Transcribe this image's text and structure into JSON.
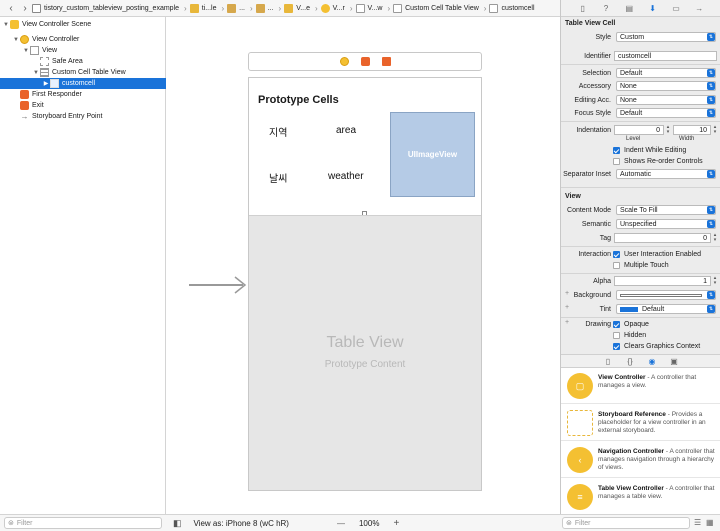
{
  "jumpbar": {
    "items": [
      "tistory_custom_tableview_posting_example",
      "ti...le",
      "...",
      "...",
      "V...e",
      "V...r",
      "V...w",
      "Custom Cell Table View",
      "customcell"
    ]
  },
  "outline": {
    "rows": [
      {
        "label": "View Controller Scene",
        "indent": 0,
        "expanded": "▼",
        "icon": "scene-icon"
      },
      {
        "label": "View Controller",
        "indent": 1,
        "expanded": "▼",
        "icon": "view-controller-icon"
      },
      {
        "label": "View",
        "indent": 2,
        "expanded": "▼",
        "icon": "view-icon"
      },
      {
        "label": "Safe Area",
        "indent": 3,
        "expanded": "",
        "icon": "safe-area-icon"
      },
      {
        "label": "Custom Cell Table View",
        "indent": 3,
        "expanded": "▼",
        "icon": "table-view-icon"
      },
      {
        "label": "customcell",
        "indent": 4,
        "expanded": "▶",
        "icon": "table-cell-icon",
        "selected": true
      },
      {
        "label": "First Responder",
        "indent": 1,
        "expanded": "",
        "icon": "first-responder-icon"
      },
      {
        "label": "Exit",
        "indent": 1,
        "expanded": "",
        "icon": "exit-icon"
      },
      {
        "label": "Storyboard Entry Point",
        "indent": 1,
        "expanded": "",
        "icon": "entry-arrow-icon"
      }
    ],
    "filter_placeholder": "Filter"
  },
  "canvas": {
    "prototype_title": "Prototype Cells",
    "labels": {
      "region_ko": "지역",
      "region_en": "area",
      "weather_ko": "날씨",
      "weather_en": "weather"
    },
    "image_view_label": "UIImageView",
    "table_view_title": "Table View",
    "table_view_subtitle": "Prototype Content",
    "view_as": "View as: iPhone 8 (wC hR)",
    "zoom": "100%",
    "zoom_out": "—",
    "zoom_in": "+"
  },
  "inspector": {
    "cell_section": "Table View Cell",
    "style_label": "Style",
    "style_value": "Custom",
    "identifier_label": "Identifier",
    "identifier_value": "customcell",
    "selection_label": "Selection",
    "selection_value": "Default",
    "accessory_label": "Accessory",
    "accessory_value": "None",
    "editing_acc_label": "Editing Acc.",
    "editing_acc_value": "None",
    "focus_style_label": "Focus Style",
    "focus_style_value": "Default",
    "indentation_label": "Indentation",
    "level_value": "0",
    "width_value": "10",
    "level_sub": "Level",
    "width_sub": "Width",
    "indent_while_editing": "Indent While Editing",
    "shows_reorder": "Shows Re-order Controls",
    "separator_label": "Separator Inset",
    "separator_value": "Automatic",
    "view_section": "View",
    "content_mode_label": "Content Mode",
    "content_mode_value": "Scale To Fill",
    "semantic_label": "Semantic",
    "semantic_value": "Unspecified",
    "tag_label": "Tag",
    "tag_value": "0",
    "interaction_label": "Interaction",
    "user_interaction": "User Interaction Enabled",
    "multiple_touch": "Multiple Touch",
    "alpha_label": "Alpha",
    "alpha_value": "1",
    "background_label": "Background",
    "tint_label": "Tint",
    "tint_value": "Default",
    "drawing_label": "Drawing",
    "opaque": "Opaque",
    "hidden": "Hidden",
    "clears_graphics": "Clears Graphics Context",
    "filter_placeholder": "Filter"
  },
  "library": [
    {
      "title": "View Controller",
      "desc": " - A controller that manages a view."
    },
    {
      "title": "Storyboard Reference",
      "desc": " - Provides a placeholder for a view controller in an external storyboard."
    },
    {
      "title": "Navigation Controller",
      "desc": " - A controller that manages navigation through a hierarchy of views."
    },
    {
      "title": "Table View Controller",
      "desc": " - A controller that manages a table view."
    }
  ],
  "colors": {
    "selection": "#1a73d9",
    "image_view": "#b5cbe6",
    "vc_yellow": "#f4c032",
    "exit_orange": "#e9632b"
  }
}
